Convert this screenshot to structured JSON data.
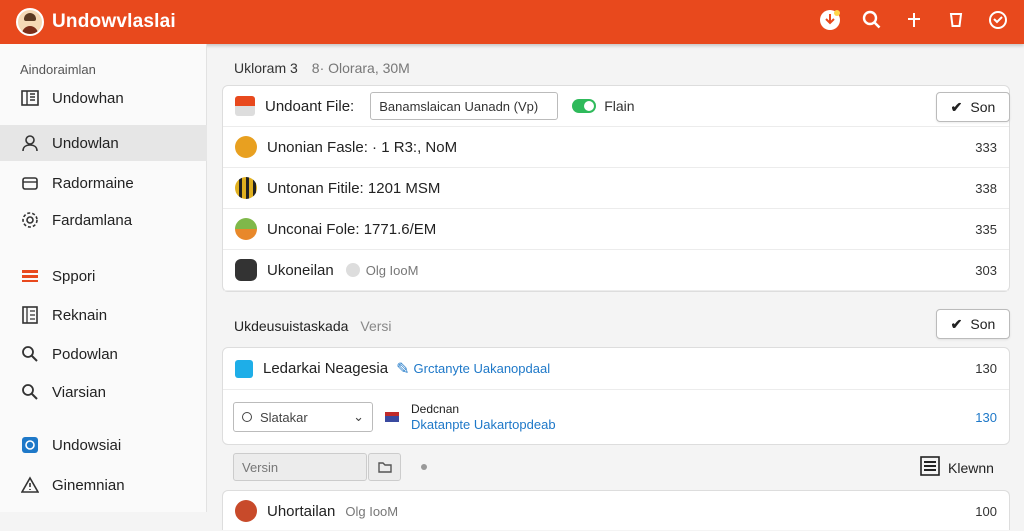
{
  "header": {
    "title": "Undowvlaslai",
    "icons": [
      "download-badge-icon",
      "search-icon",
      "plus-icon",
      "cup-icon",
      "chat-icon"
    ]
  },
  "sidebar": {
    "header": "Aindoraimlan",
    "items": [
      {
        "label": "Undowhan",
        "icon": "book-icon"
      },
      {
        "label": "Undowlan",
        "icon": "user-icon",
        "active": true
      },
      {
        "label": "Radormaine",
        "icon": "box-icon"
      },
      {
        "label": "Fardamlana",
        "icon": "gear-icon"
      },
      {
        "label": "Sppori",
        "icon": "stack-icon"
      },
      {
        "label": "Reknain",
        "icon": "list-icon"
      },
      {
        "label": "Podowlan",
        "icon": "search-icon"
      },
      {
        "label": "Viarsian",
        "icon": "search-icon"
      },
      {
        "label": "Undowsiai",
        "icon": "app-icon"
      },
      {
        "label": "Ginemnian",
        "icon": "warning-icon"
      }
    ]
  },
  "main": {
    "crumb": "Ukloram 3",
    "crumb_muted": "8· Olorara, 30M",
    "files_card": {
      "header_label": "Undoant File:",
      "search_value": "Banamslaican Uanadn (Vp)",
      "toggle_label": "Flain",
      "son_label": "Son",
      "rows": [
        {
          "text": "Unonian Fasle: · 1 R3:, NoM",
          "num": "333"
        },
        {
          "text": "Untonan Fitile: 1201 MSM",
          "num": "338"
        },
        {
          "text": "Unconai Fole: 1771.6/EM",
          "num": "335"
        },
        {
          "text": "Ukoneilan",
          "sub": "Olg IooM",
          "num": "303"
        }
      ]
    },
    "section": {
      "title": "Ukdeusuistaskada",
      "muted": "Versi",
      "son_label": "Son"
    },
    "detail_card": {
      "row1_label": "Ledarkai Neagesia",
      "row1_link": "Grctanyte Uakanopdaal",
      "row1_num": "130",
      "select_value": "Slatakar",
      "mini_title": "Dedcnan",
      "mini_link": "Dkatanpte Uakartopdeab",
      "row2_num": "130"
    },
    "version_placeholder": "Versin",
    "kleinn_label": "Klewnn",
    "last_row": {
      "text": "Uhortailan",
      "sub": "Olg IooM",
      "num": "100"
    }
  },
  "colors": {
    "accent": "#e8491d",
    "toggle": "#2fba5b",
    "link": "#1e78c8"
  }
}
